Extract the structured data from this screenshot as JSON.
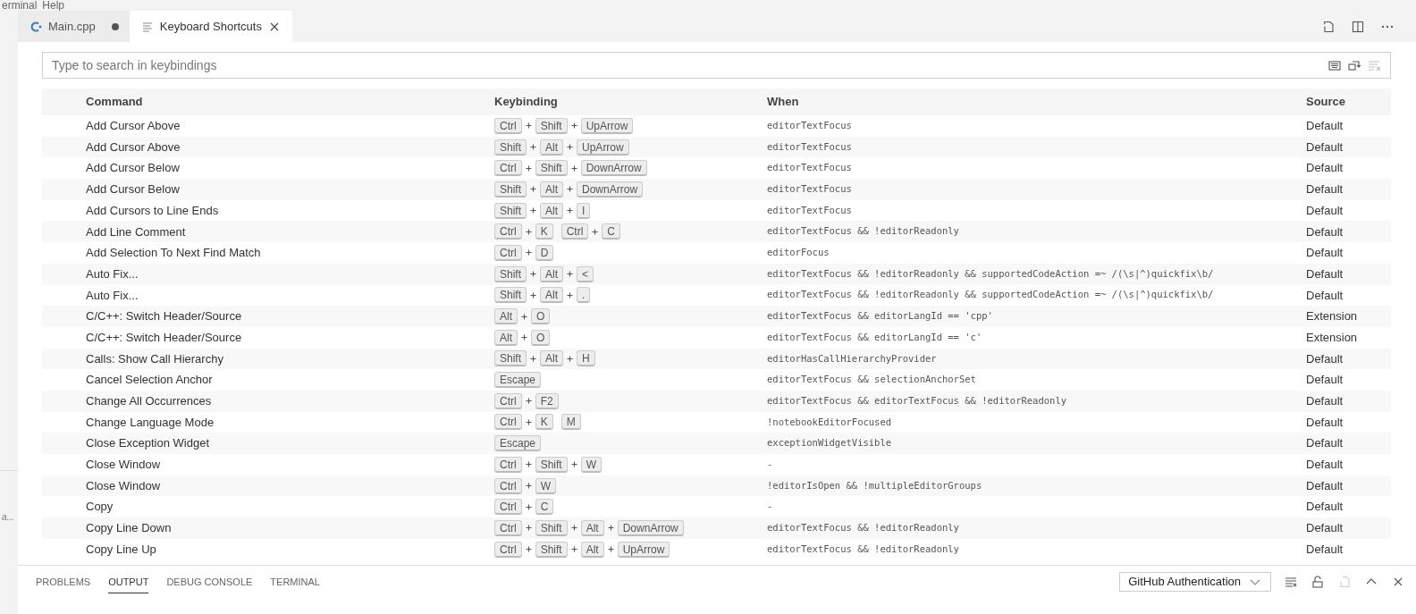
{
  "menu": [
    "erminal",
    "Help"
  ],
  "sidebar": {
    "label": "a..."
  },
  "tabs": [
    {
      "label": "Main.cpp",
      "selected": false,
      "modified": true,
      "kind": "code"
    },
    {
      "label": "Keyboard Shortcuts",
      "selected": true,
      "modified": false,
      "kind": "settings"
    }
  ],
  "search": {
    "placeholder": "Type to search in keybindings"
  },
  "table": {
    "columns": [
      "Command",
      "Keybinding",
      "When",
      "Source"
    ],
    "rows": [
      {
        "command": "Add Cursor Above",
        "keys": [
          [
            "Ctrl",
            "Shift",
            "UpArrow"
          ]
        ],
        "when": "editorTextFocus",
        "source": "Default"
      },
      {
        "command": "Add Cursor Above",
        "keys": [
          [
            "Shift",
            "Alt",
            "UpArrow"
          ]
        ],
        "when": "editorTextFocus",
        "source": "Default"
      },
      {
        "command": "Add Cursor Below",
        "keys": [
          [
            "Ctrl",
            "Shift",
            "DownArrow"
          ]
        ],
        "when": "editorTextFocus",
        "source": "Default"
      },
      {
        "command": "Add Cursor Below",
        "keys": [
          [
            "Shift",
            "Alt",
            "DownArrow"
          ]
        ],
        "when": "editorTextFocus",
        "source": "Default"
      },
      {
        "command": "Add Cursors to Line Ends",
        "keys": [
          [
            "Shift",
            "Alt",
            "I"
          ]
        ],
        "when": "editorTextFocus",
        "source": "Default"
      },
      {
        "command": "Add Line Comment",
        "keys": [
          [
            "Ctrl",
            "K"
          ],
          [
            "Ctrl",
            "C"
          ]
        ],
        "when": "editorTextFocus && !editorReadonly",
        "source": "Default"
      },
      {
        "command": "Add Selection To Next Find Match",
        "keys": [
          [
            "Ctrl",
            "D"
          ]
        ],
        "when": "editorFocus",
        "source": "Default"
      },
      {
        "command": "Auto Fix...",
        "keys": [
          [
            "Shift",
            "Alt",
            "<"
          ]
        ],
        "when": "editorTextFocus && !editorReadonly && supportedCodeAction =~ /(\\s|^)quickfix\\b/",
        "source": "Default"
      },
      {
        "command": "Auto Fix...",
        "keys": [
          [
            "Shift",
            "Alt",
            "."
          ]
        ],
        "when": "editorTextFocus && !editorReadonly && supportedCodeAction =~ /(\\s|^)quickfix\\b/",
        "source": "Default"
      },
      {
        "command": "C/C++: Switch Header/Source",
        "keys": [
          [
            "Alt",
            "O"
          ]
        ],
        "when": "editorTextFocus && editorLangId == 'cpp'",
        "source": "Extension"
      },
      {
        "command": "C/C++: Switch Header/Source",
        "keys": [
          [
            "Alt",
            "O"
          ]
        ],
        "when": "editorTextFocus && editorLangId == 'c'",
        "source": "Extension"
      },
      {
        "command": "Calls: Show Call Hierarchy",
        "keys": [
          [
            "Shift",
            "Alt",
            "H"
          ]
        ],
        "when": "editorHasCallHierarchyProvider",
        "source": "Default"
      },
      {
        "command": "Cancel Selection Anchor",
        "keys": [
          [
            "Escape"
          ]
        ],
        "when": "editorTextFocus && selectionAnchorSet",
        "source": "Default"
      },
      {
        "command": "Change All Occurrences",
        "keys": [
          [
            "Ctrl",
            "F2"
          ]
        ],
        "when": "editorTextFocus && editorTextFocus && !editorReadonly",
        "source": "Default"
      },
      {
        "command": "Change Language Mode",
        "keys": [
          [
            "Ctrl",
            "K"
          ],
          [
            "M"
          ]
        ],
        "when": "!notebookEditorFocused",
        "source": "Default"
      },
      {
        "command": "Close Exception Widget",
        "keys": [
          [
            "Escape"
          ]
        ],
        "when": "exceptionWidgetVisible",
        "source": "Default"
      },
      {
        "command": "Close Window",
        "keys": [
          [
            "Ctrl",
            "Shift",
            "W"
          ]
        ],
        "when": "-",
        "source": "Default"
      },
      {
        "command": "Close Window",
        "keys": [
          [
            "Ctrl",
            "W"
          ]
        ],
        "when": "!editorIsOpen && !multipleEditorGroups",
        "source": "Default"
      },
      {
        "command": "Copy",
        "keys": [
          [
            "Ctrl",
            "C"
          ]
        ],
        "when": "-",
        "source": "Default"
      },
      {
        "command": "Copy Line Down",
        "keys": [
          [
            "Ctrl",
            "Shift",
            "Alt",
            "DownArrow"
          ]
        ],
        "when": "editorTextFocus && !editorReadonly",
        "source": "Default"
      },
      {
        "command": "Copy Line Up",
        "keys": [
          [
            "Ctrl",
            "Shift",
            "Alt",
            "UpArrow"
          ]
        ],
        "when": "editorTextFocus && !editorReadonly",
        "source": "Default"
      }
    ]
  },
  "panel": {
    "tabs": [
      {
        "label": "PROBLEMS",
        "selected": false
      },
      {
        "label": "OUTPUT",
        "selected": true
      },
      {
        "label": "DEBUG CONSOLE",
        "selected": false
      },
      {
        "label": "TERMINAL",
        "selected": false
      }
    ],
    "channel": "GitHub Authentication"
  }
}
